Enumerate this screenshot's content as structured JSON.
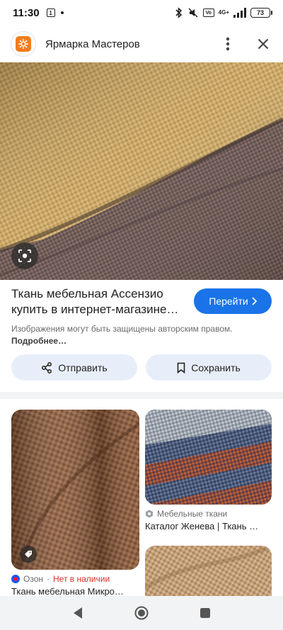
{
  "status_bar": {
    "time": "11:30",
    "sim_label": "1",
    "network": "4G+",
    "vo_label": "Vo",
    "battery": "73"
  },
  "header": {
    "site_name": "Ярмарка Мастеров"
  },
  "result": {
    "title": "Ткань мебельная Ассензио купить в интернет-магазине…",
    "visit_label": "Перейти",
    "disclaimer": "Изображения могут быть защищены авторским правом.",
    "more_link": "Подробнее…"
  },
  "actions": {
    "share_label": "Отправить",
    "save_label": "Сохранить"
  },
  "related": [
    {
      "source": "Озон",
      "separator": "·",
      "status": "Нет в наличии",
      "title": "Ткань мебельная Микро…"
    },
    {
      "source": "Мебельные ткани",
      "title": "Каталог Женева | Ткань …"
    }
  ],
  "colors": {
    "accent": "#1a73e8",
    "pill_bg": "#e8eef9",
    "out_of_stock": "#d93025"
  }
}
